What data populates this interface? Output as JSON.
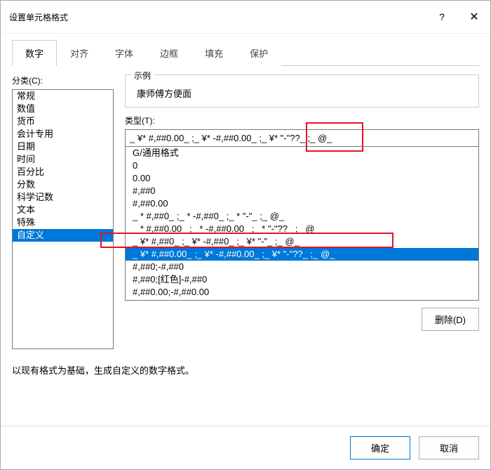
{
  "dialog": {
    "title": "设置单元格格式"
  },
  "tabs": [
    "数字",
    "对齐",
    "字体",
    "边框",
    "填充",
    "保护"
  ],
  "activeTab": 0,
  "categoryLabel": "分类(C):",
  "categories": [
    "常规",
    "数值",
    "货币",
    "会计专用",
    "日期",
    "时间",
    "百分比",
    "分数",
    "科学记数",
    "文本",
    "特殊",
    "自定义"
  ],
  "selectedCategory": 11,
  "sample": {
    "legend": "示例",
    "text": "康师傅方便面"
  },
  "typeLabel": "类型(T):",
  "typeInput": "_ ¥* #,##0.00_ ;_ ¥* -#,##0.00_ ;_ ¥* \"-\"??_ ;_ @_",
  "typeItems": [
    "G/通用格式",
    "0",
    "0.00",
    "#,##0",
    "#,##0.00",
    "_ * #,##0_ ;_ * -#,##0_ ;_ * \"-\"_ ;_ @_",
    "_ * #,##0.00_ ;_ * -#,##0.00_ ;_ * \"-\"??_ ;_ @_",
    "_ ¥* #,##0_ ;_ ¥* -#,##0_ ;_ ¥* \"-\"_ ;_ @_",
    "_ ¥* #,##0.00_ ;_ ¥* -#,##0.00_ ;_ ¥* \"-\"??_ ;_ @_",
    "#,##0;-#,##0",
    "#,##0;[红色]-#,##0",
    "#,##0.00;-#,##0.00"
  ],
  "selectedType": 8,
  "deleteBtn": "删除(D)",
  "hint": "以现有格式为基础，生成自定义的数字格式。",
  "footer": {
    "ok": "确定",
    "cancel": "取消"
  }
}
